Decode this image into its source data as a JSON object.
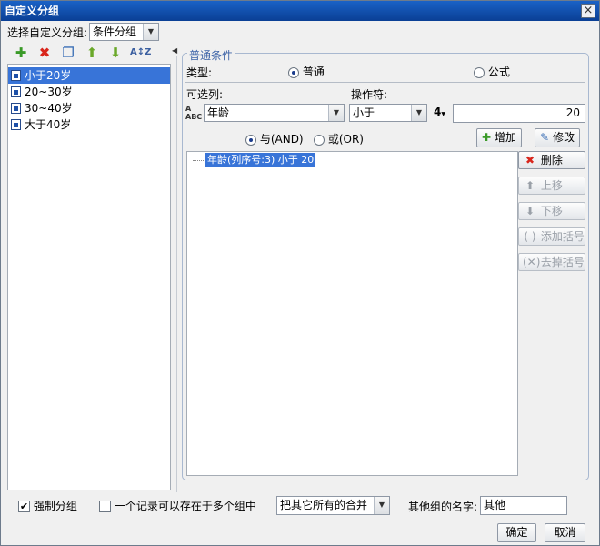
{
  "window": {
    "title": "自定义分组",
    "close_label": "×"
  },
  "top": {
    "select_label": "选择自定义分组:",
    "group_type": "条件分组"
  },
  "toolbar": {
    "add_icon": "plus-icon",
    "delete_icon": "red-x-icon",
    "copy_icon": "copy-icon",
    "up_icon": "arrow-up-icon",
    "down_icon": "arrow-down-icon",
    "sort_icon": "sort-az-icon"
  },
  "groups": [
    {
      "label": "小于20岁",
      "selected": true
    },
    {
      "label": "20~30岁",
      "selected": false
    },
    {
      "label": "30~40岁",
      "selected": false
    },
    {
      "label": "大于40岁",
      "selected": false
    }
  ],
  "condition": {
    "section_title": "普通条件",
    "type_label": "类型:",
    "type_normal": "普通",
    "type_formula": "公式",
    "column_label": "可选列:",
    "column_value": "年龄",
    "operator_label": "操作符:",
    "operator_value": "小于",
    "value_type_glyph": "4",
    "value": "20",
    "and_label": "与(AND)",
    "or_label": "或(OR)",
    "add_button": "增加",
    "modify_button": "修改",
    "tree_item": "年龄(列序号:3) 小于 20"
  },
  "side_buttons": {
    "delete": "删除",
    "move_up": "上移",
    "move_down": "下移",
    "add_bracket": "添加括号",
    "remove_bracket": "去掉括号"
  },
  "bottom": {
    "force_group_label": "强制分组",
    "multi_group_label": "一个记录可以存在于多个组中",
    "merge_option": "把其它所有的合并",
    "other_name_label": "其他组的名字:",
    "other_name_value": "其他",
    "ok_button": "确定",
    "cancel_button": "取消"
  }
}
